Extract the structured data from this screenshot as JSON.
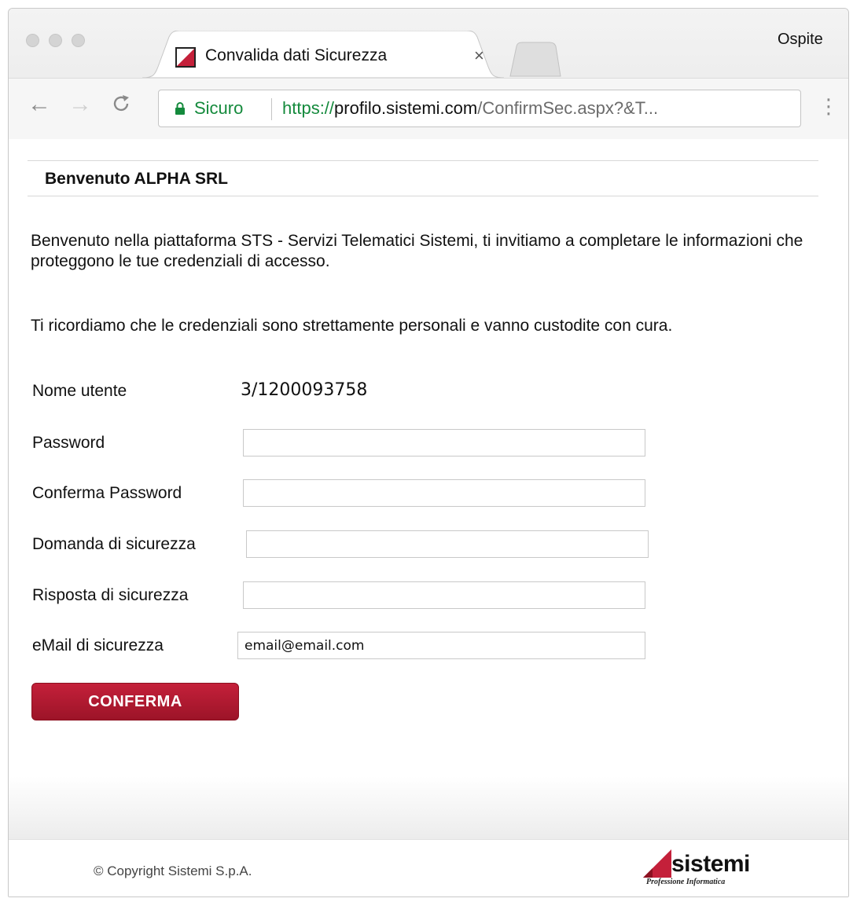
{
  "browser": {
    "tab_title": "Convalida dati Sicurezza",
    "tab_close": "×",
    "profile_label": "Ospite",
    "secure_label": "Sicuro",
    "url_scheme": "https://",
    "url_host": "profilo.sistemi.com",
    "url_path": "/ConfirmSec.aspx?&T...",
    "icons": [
      "back-arrow-icon",
      "forward-arrow-icon",
      "reload-icon",
      "lock-icon",
      "kebab-menu-icon",
      "favicon-icon"
    ]
  },
  "page": {
    "welcome_title": "Benvenuto ALPHA SRL",
    "intro_text": "Benvenuto nella piattaforma STS - Servizi Telematici Sistemi, ti invitiamo a completare le informazioni che proteggono le tue credenziali di accesso.",
    "reminder_text": "Ti ricordiamo che le credenziali sono strettamente personali e vanno custodite con cura.",
    "form": {
      "username_label": "Nome utente",
      "username_value": "3/1200093758",
      "password_label": "Password",
      "password_value": "",
      "confirm_password_label": "Conferma Password",
      "confirm_password_value": "",
      "security_question_label": "Domanda di sicurezza",
      "security_question_value": "",
      "security_answer_label": "Risposta di sicurezza",
      "security_answer_value": "",
      "security_email_label": "eMail di sicurezza",
      "security_email_value": "email@email.com",
      "submit_label": "CONFERMA"
    },
    "footer": {
      "copyright": "© Copyright Sistemi S.p.A.",
      "logo_word": "sistemi",
      "logo_sub": "Professione Informatica"
    }
  },
  "colors": {
    "secure_green": "#148a3c",
    "button_red": "#b01a31",
    "brand_red": "#c4203a"
  }
}
